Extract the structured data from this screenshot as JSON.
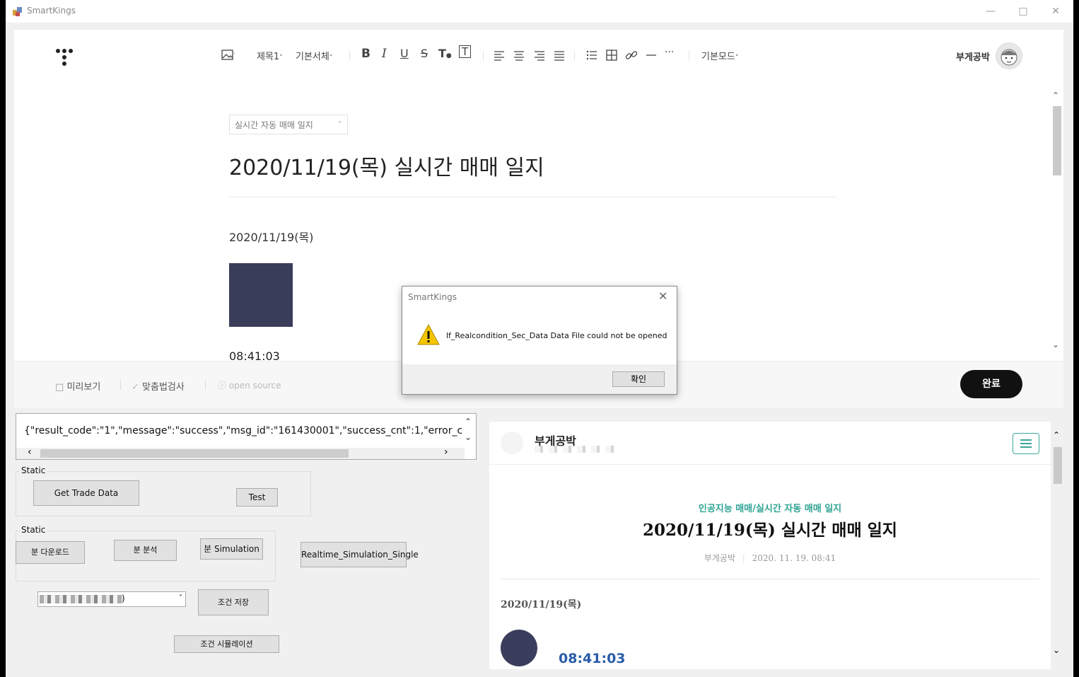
{
  "window": {
    "title": "SmartKings"
  },
  "toolbar": {
    "heading_label": "제목1",
    "font_label": "기본서체",
    "mode_label": "기본모드",
    "user_name": "부게공박"
  },
  "post": {
    "category": "실시간 자동 매매 일지",
    "title": "2020/11/19(목) 실시간 매매 일지",
    "date": "2020/11/19(목)",
    "time": "08:41:03"
  },
  "footer": {
    "preview_label": "미리보기",
    "spellcheck_label": "맞춤법검사",
    "opensource_label": "open source",
    "done_label": "완료"
  },
  "controls": {
    "json_output": "{\"result_code\":\"1\",\"message\":\"success\",\"msg_id\":\"161430001\",\"success_cnt\":1,\"error_c",
    "group1_label": "Static",
    "get_trade_label": "Get Trade Data",
    "test_label": "Test",
    "group2_label": "Static",
    "min_download_label": "분 다운로드",
    "min_analysis_label": "분 분석",
    "min_simulation_label": "분 Simulation",
    "realtime_sim_label": "Realtime_Simulation_Single",
    "combo_suffix": ")",
    "save_condition_label": "조건 저장",
    "condition_sim_label": "조건 시뮬레이션"
  },
  "preview": {
    "blog_name": "부게공박",
    "category": "인공지능 매매/실시간 자동 매매 일지",
    "title": "2020/11/19(목) 실시간 매매 일지",
    "author": "부게공박",
    "datetime": "2020. 11. 19. 08:41",
    "date": "2020/11/19(목)",
    "time": "08:41:03"
  },
  "dialog": {
    "title": "SmartKings",
    "message": "lf_Realcondition_Sec_Data Data File could not be opened",
    "ok_label": "확인"
  },
  "colors": {
    "accent": "#3aa79a",
    "done_button": "#111111",
    "time_link": "#2a5caa",
    "image_block": "#393d5a"
  }
}
